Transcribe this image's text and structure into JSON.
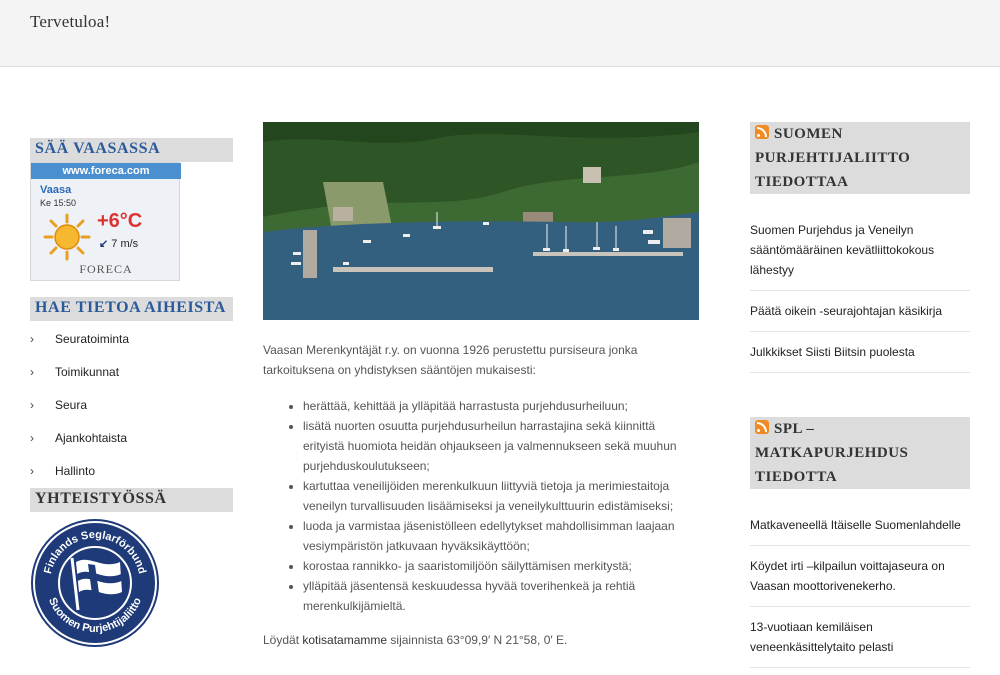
{
  "header": {
    "site_title": "Tervetuloa!"
  },
  "left": {
    "weather": {
      "title": "SÄÄ VAASASSA",
      "banner": "www.foreca.com",
      "city": "Vaasa",
      "time": "Ke 15:50",
      "temperature": "+6°C",
      "wind": "7 m/s",
      "brand": "FORECA"
    },
    "topics": {
      "title": "HAE TIETOA AIHEISTA",
      "items": [
        "Seuratoiminta",
        "Toimikunnat",
        "Seura",
        "Ajankohtaista",
        "Hallinto"
      ]
    },
    "partners": {
      "title": "YHTEISTYÖSSÄ",
      "emblem_text_top": "Finlands Seglarförbund",
      "emblem_text_bottom": "Suomen Purjehtijaliitto"
    }
  },
  "center": {
    "intro": "Vaasan Merenkyntäjät r.y. on vuonna 1926 perustettu pursiseura jonka tarkoituksena on yhdistyksen sääntöjen mukaisesti:",
    "bullets": [
      "herättää, kehittää ja ylläpitää harrastusta purjehdusurheiluun;",
      "lisätä nuorten osuutta purjehdusurheilun harrastajina sekä kiinnittä erityistä huomiota heidän ohjaukseen ja valmennukseen sekä muuhun purjehduskoulutukseen;",
      "kartuttaa veneilijöiden merenkulkuun liittyviä tietoja ja merimiestaitoja veneilyn turvallisuuden lisäämiseksi ja veneilykulttuurin edistämiseksi;",
      "luoda ja varmistaa jäsenistölleen edellytykset mahdollisimman laajaan vesiympäristön jatkuvaan hyväksikäyttöön;",
      "korostaa rannikko- ja saaristomiljöön säilyttämisen merkitystä;",
      "ylläpitää jäsentensä keskuudessa hyvää toverihenkeä ja rehtiä merenkulkijämieltä."
    ],
    "coords_prefix": "Löydät",
    "coords_link": "kotisatamamme",
    "coords_suffix": "sijainnista  63°09,9′ N 21°58, 0′ E."
  },
  "right": {
    "feed1": {
      "title": "SUOMEN PURJEHTIJALIITTO TIEDOTTAA",
      "items": [
        "Suomen Purjehdus ja Veneilyn sääntömääräinen kevätliittokokous lähestyy",
        "Päätä oikein -seurajohtajan käsikirja",
        "Julkkikset Siisti Biitsin puolesta"
      ]
    },
    "feed2": {
      "title": "SPL – MATKAPURJEHDUS TIEDOTTA",
      "items": [
        "Matkaveneellä Itäiselle Suomenlahdelle",
        "Köydet irti –kilpailun voittajaseura on Vaasan moottorivenekerho.",
        "13-vuotiaan kemiläisen veneenkäsittelytaito pelasti"
      ]
    }
  },
  "colors": {
    "accent": "#2a5a9a",
    "widget_bg": "#dcdcdc",
    "rss": "#f08a24"
  }
}
